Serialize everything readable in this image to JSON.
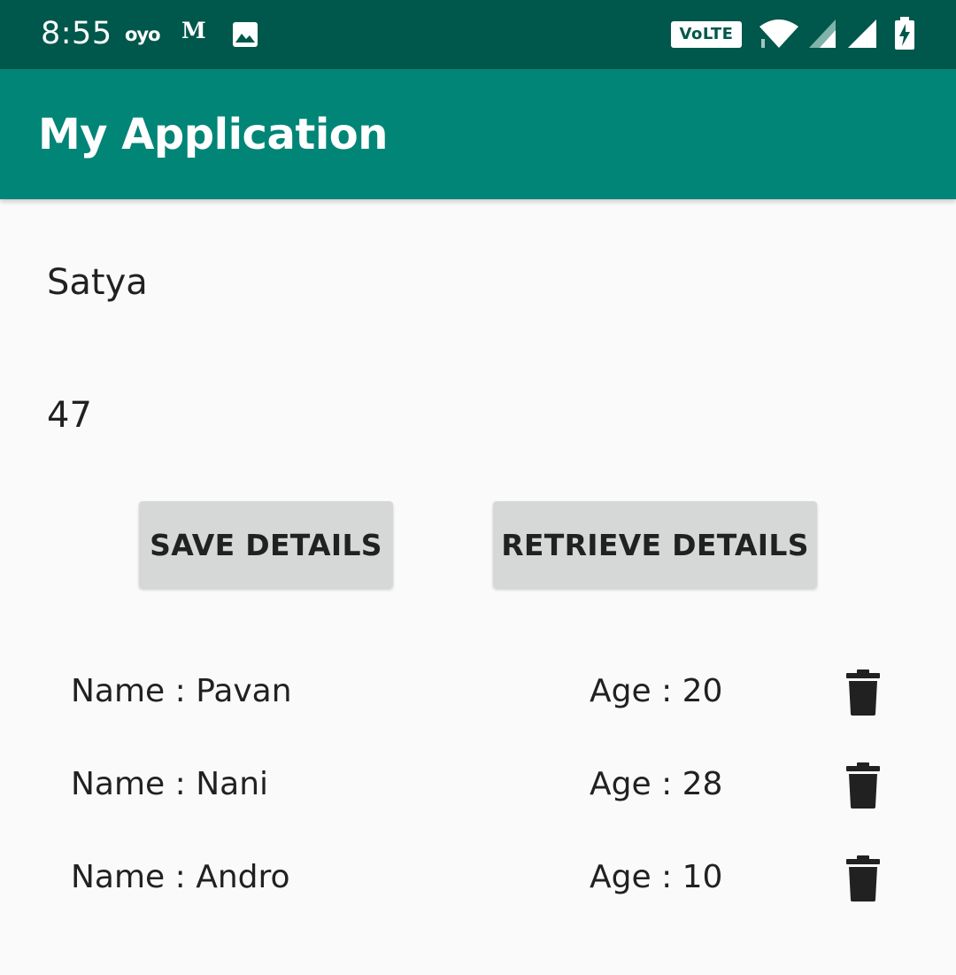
{
  "status_bar": {
    "time": "8:55",
    "notif_oyo": "oyo",
    "notif_m": "M",
    "volte": "VoLTE 1"
  },
  "app_bar": {
    "title": "My Application"
  },
  "form": {
    "name_value": "Satya",
    "age_value": "47"
  },
  "buttons": {
    "save_label": "SAVE DETAILS",
    "retrieve_label": "RETRIEVE DETAILS"
  },
  "records": [
    {
      "name": "Name : Pavan",
      "age": "Age : 20"
    },
    {
      "name": "Name : Nani",
      "age": "Age : 28"
    },
    {
      "name": "Name : Andro",
      "age": "Age : 10"
    }
  ],
  "colors": {
    "status_bar": "#00574b",
    "app_bar": "#008577",
    "background": "#fafafa",
    "button": "#d6d7d7"
  },
  "icons": {
    "delete": "trash-icon"
  }
}
